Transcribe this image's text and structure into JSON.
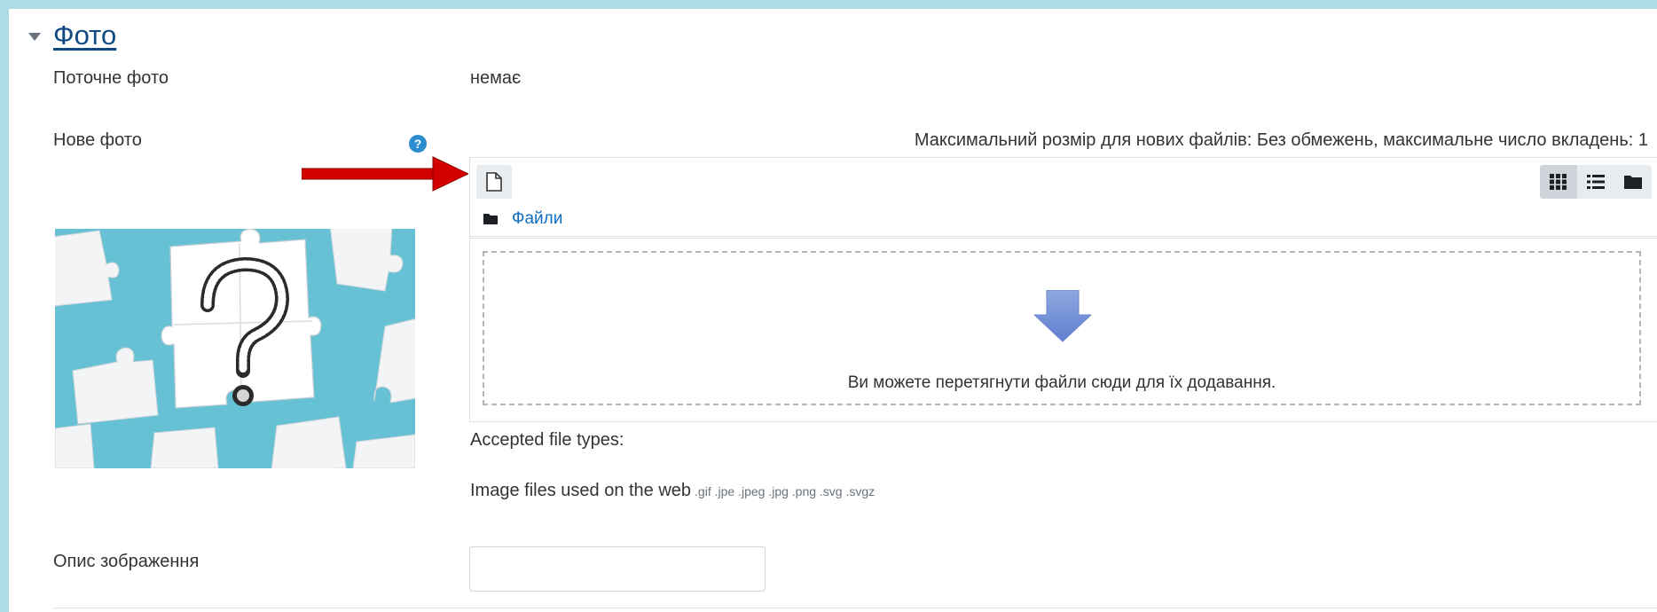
{
  "section": {
    "title": "Фото"
  },
  "current_photo": {
    "label": "Поточне фото",
    "value": "немає"
  },
  "new_photo": {
    "label": "Нове фото",
    "help_icon": "question-circle-icon",
    "max_size_text": "Максимальний розмір для нових файлів: Без обмежень, максимальне число вкладень: 1"
  },
  "filepicker": {
    "add_file_icon": "file-icon",
    "views": [
      "grid-view-icon",
      "list-view-icon",
      "folder-view-icon"
    ],
    "path_folder_icon": "folder-icon",
    "path_label": "Файли",
    "drop_text": "Ви можете перетягнути файли сюди для їх додавання."
  },
  "accepted": {
    "label": "Accepted file types:",
    "type_name": "Image files used on the web",
    "extensions": ".gif .jpe .jpeg .jpg .png .svg .svgz"
  },
  "image_description": {
    "label": "Опис зображення",
    "value": ""
  },
  "colors": {
    "accent": "#0f6cbf",
    "frame": "#aedbe6",
    "arrow": "#d40000"
  }
}
